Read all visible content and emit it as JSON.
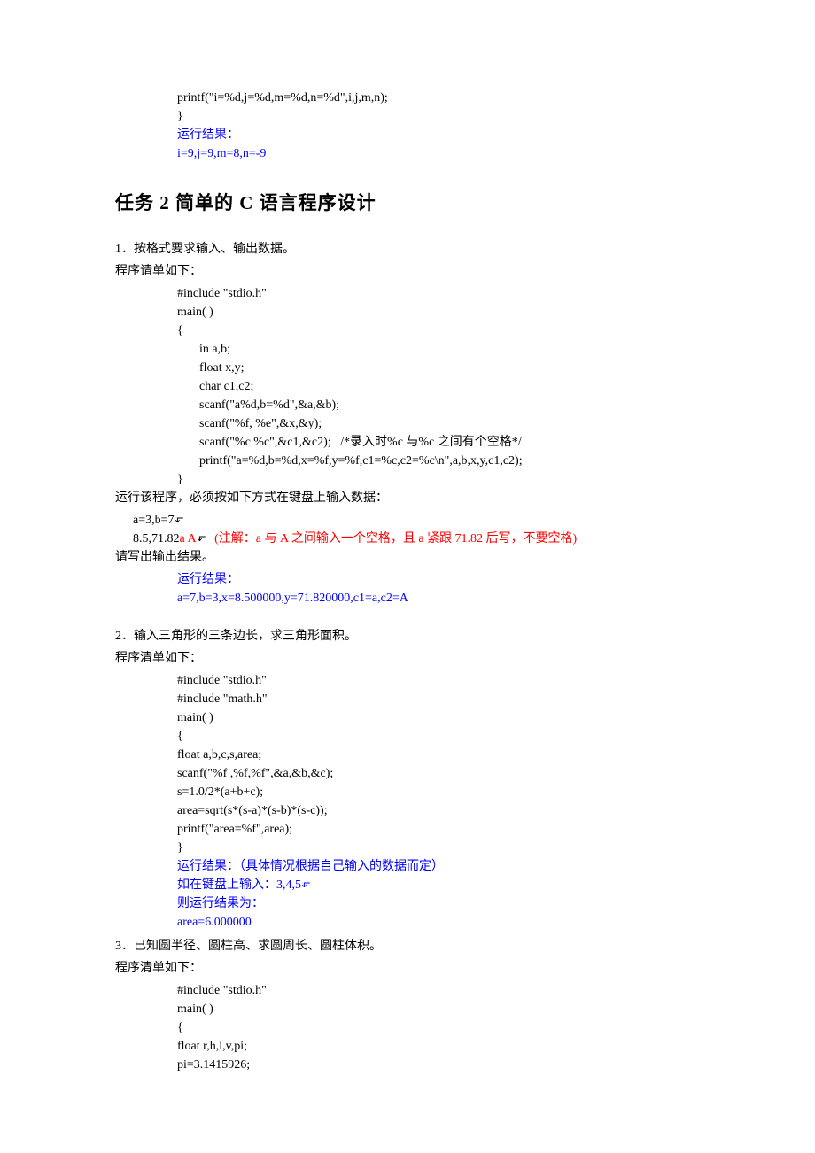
{
  "top_code": {
    "l1": "printf(\"i=%d,j=%d,m=%d,n=%d\",i,j,m,n);",
    "l2": "}",
    "result_label": "运行结果：",
    "result": "i=9,j=9,m=8,n=-9"
  },
  "task_title": "任务 2  简单的 C 语言程序设计",
  "q1": {
    "desc": "1．按格式要求输入、输出数据。",
    "prog_label": "程序请单如下：",
    "code": {
      "l1": "#include \"stdio.h\"",
      "l2": "main( )",
      "l3": "{",
      "l4": "in a,b;",
      "l5": "float x,y;",
      "l6": "char c1,c2;",
      "l7": "scanf(\"a%d,b=%d\",&a,&b);",
      "l8": "scanf(\"%f, %e\",&x,&y);",
      "l9": "scanf(\"%c %c\",&c1,&c2);   /*录入时%c 与%c 之间有个空格*/",
      "l10": "printf(\"a=%d,b=%d,x=%f,y=%f,c1=%c,c2=%c\\n\",a,b,x,y,c1,c2);",
      "l11": "}"
    },
    "run_note": "运行该程序，必须按如下方式在键盘上输入数据：",
    "input1_a": "a=3,b=7",
    "input2_a": "8.5,71.82",
    "input2_b": "a  A",
    "input2_c": "(注解：a 与 A 之间输入一个空格，且 a 紧跟 71.82 后写，不要空格)",
    "output_prompt": "请写出输出结果。",
    "result_label": "运行结果：",
    "result": "a=7,b=3,x=8.500000,y=71.820000,c1=a,c2=A"
  },
  "q2": {
    "desc": "2．输入三角形的三条边长，求三角形面积。",
    "prog_label": "程序清单如下：",
    "code": {
      "l1": "#include \"stdio.h\"",
      "l2": "#include \"math.h\"",
      "l3": "main( )",
      "l4": "{",
      "l5": "float a,b,c,s,area;",
      "l6": "scanf(\"%f ,%f,%f\",&a,&b,&c);",
      "l7": "s=1.0/2*(a+b+c);",
      "l8": "area=sqrt(s*(s-a)*(s-b)*(s-c));",
      "l9": "printf(\"area=%f\",area);",
      "l10": "}"
    },
    "result_label": "运行结果：（具体情况根据自己输入的数据而定）",
    "input_note_a": "如在键盘上输入：3,4,5",
    "input_note_b": "则运行结果为：",
    "result": "area=6.000000"
  },
  "q3": {
    "desc": "3．已知圆半径、圆柱高、求圆周长、圆柱体积。",
    "prog_label": "程序清单如下：",
    "code": {
      "l1": "#include \"stdio.h\"",
      "l2": "main( )",
      "l3": "{",
      "l4": "float r,h,l,v,pi;",
      "l5": "pi=3.1415926;"
    }
  }
}
